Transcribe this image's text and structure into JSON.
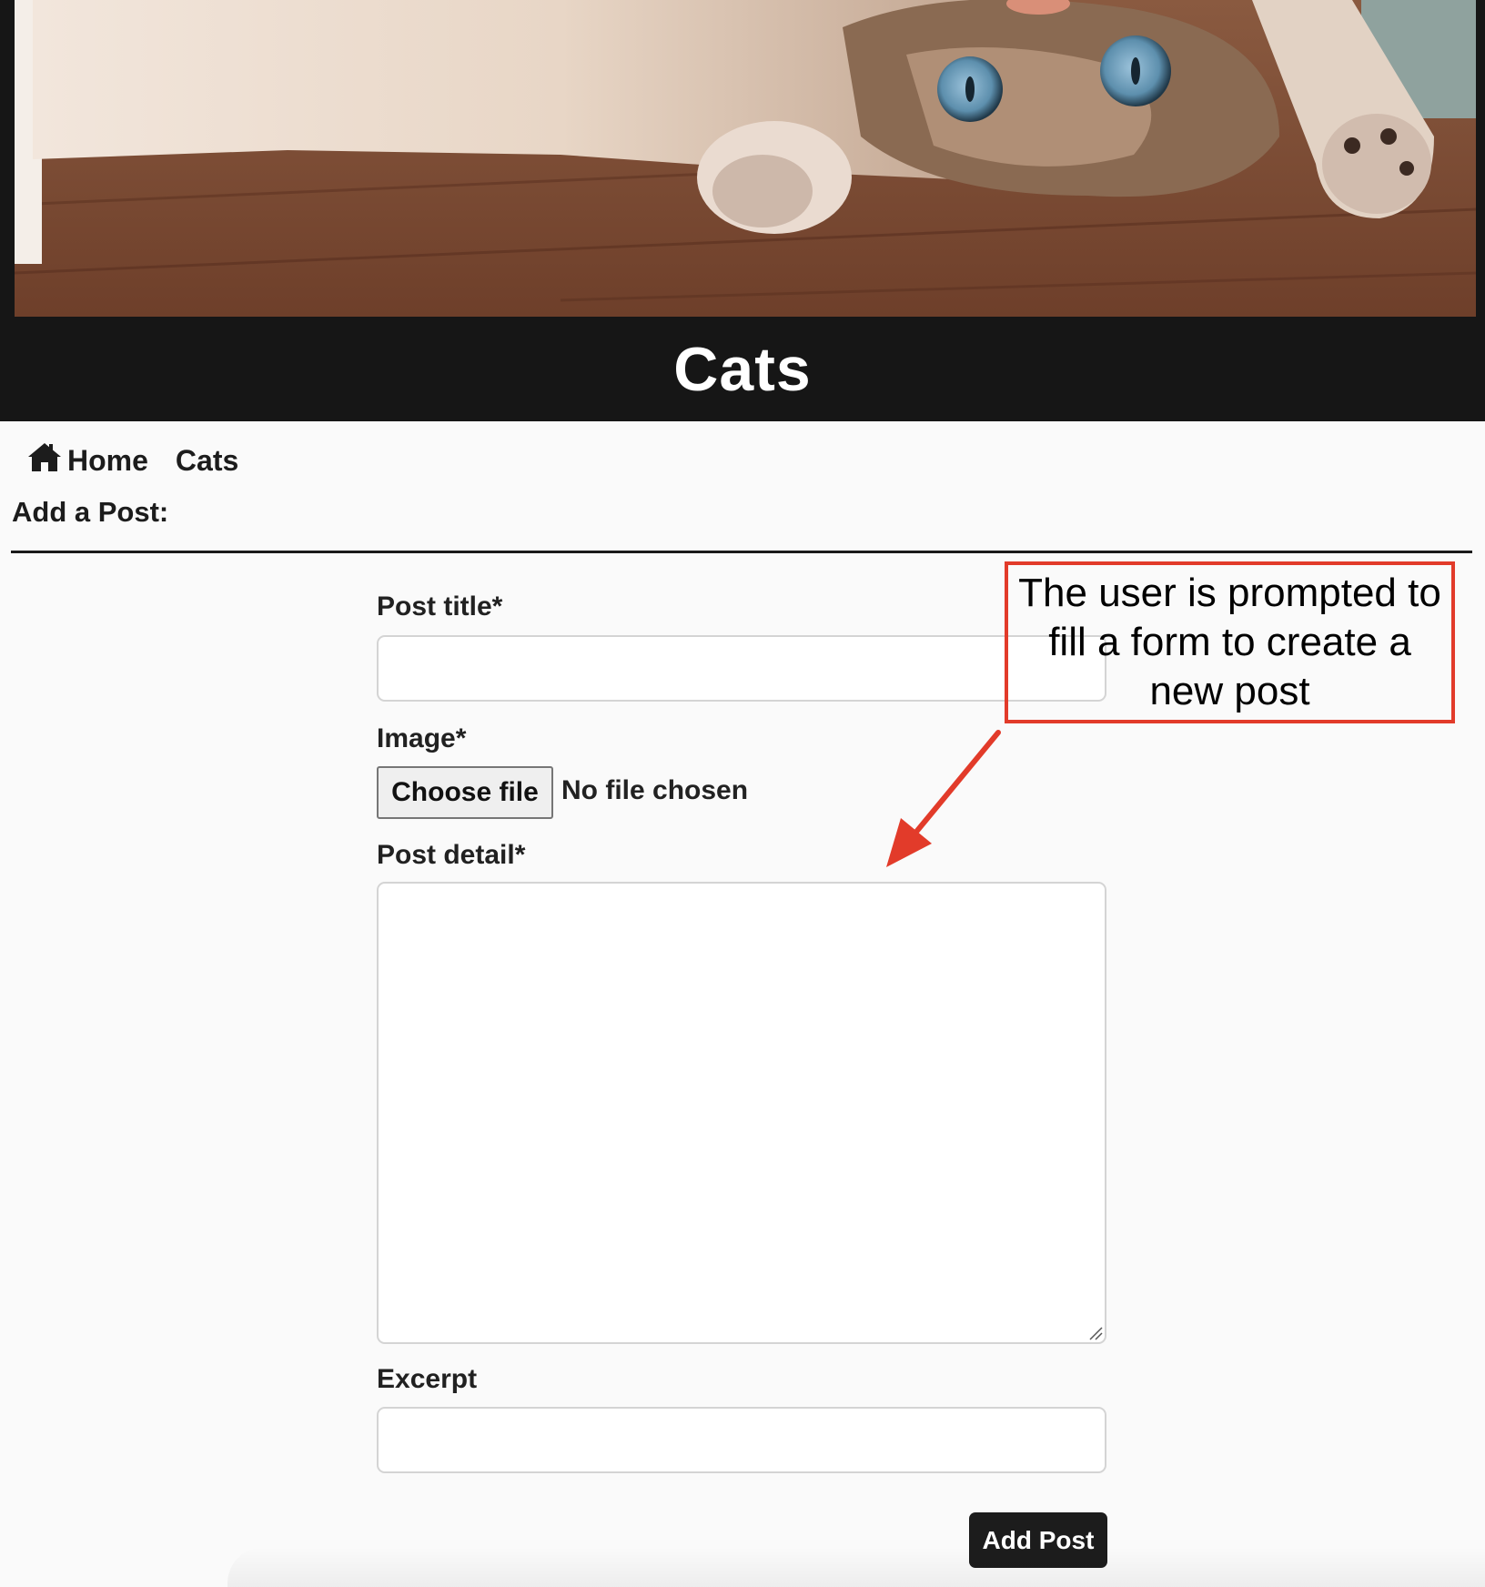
{
  "header": {
    "hero_image": "cat lying on wooden floor",
    "site_title": "Cats"
  },
  "nav": {
    "home_icon": "home-icon",
    "home_label": "Home",
    "category_label": "Cats"
  },
  "page": {
    "heading": "Add a Post:"
  },
  "form": {
    "title_label": "Post title*",
    "title_value": "",
    "image_label": "Image*",
    "file_button_label": "Choose file",
    "file_status": "No file chosen",
    "detail_label": "Post detail*",
    "detail_value": "",
    "excerpt_label": "Excerpt",
    "excerpt_value": "",
    "submit_label": "Add Post"
  },
  "annotation": {
    "text": "The user is prompted to fill a form to create a new post",
    "color": "#e23b2a"
  },
  "colors": {
    "header_bg": "#161616",
    "page_bg": "#fafafa",
    "button_dark": "#1c1c1c"
  }
}
